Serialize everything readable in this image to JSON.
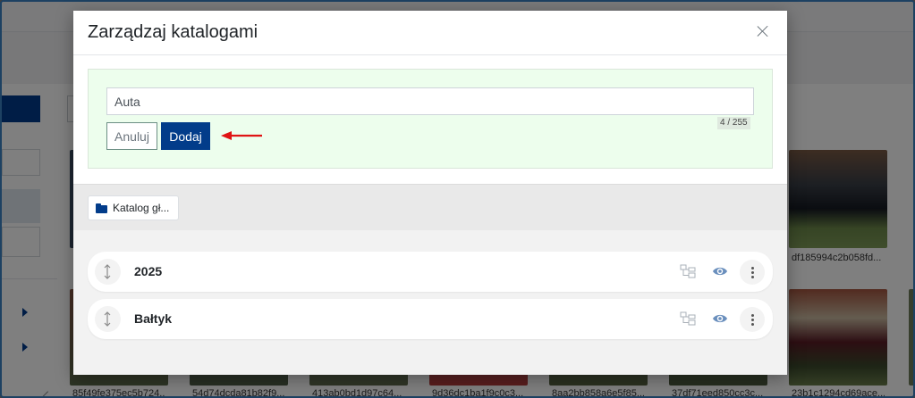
{
  "modal": {
    "title": "Zarządzaj katalogami",
    "input_value": "Auta",
    "counter": "4 / 255",
    "cancel_label": "Anuluj",
    "add_label": "Dodaj",
    "breadcrumb_label": "Katalog gł..."
  },
  "catalogs": [
    {
      "name": "2025"
    },
    {
      "name": "Bałtyk"
    }
  ],
  "background": {
    "thumb_captions": [
      "85f49fe375ec5b724...",
      "54d74dcda81b82f9...",
      "413ab0bd1d97c64...",
      "9d36dc1ba1f9c0c3...",
      "8aa2bb858a6e5f85...",
      "37df71eed850cc3c...",
      "23b1c1294cd69ace..."
    ],
    "right_caption": "df185994c2b058fd..."
  },
  "colors": {
    "primary": "#023c8a",
    "panel_bg": "#edfeed",
    "arrow": "#e01414"
  }
}
